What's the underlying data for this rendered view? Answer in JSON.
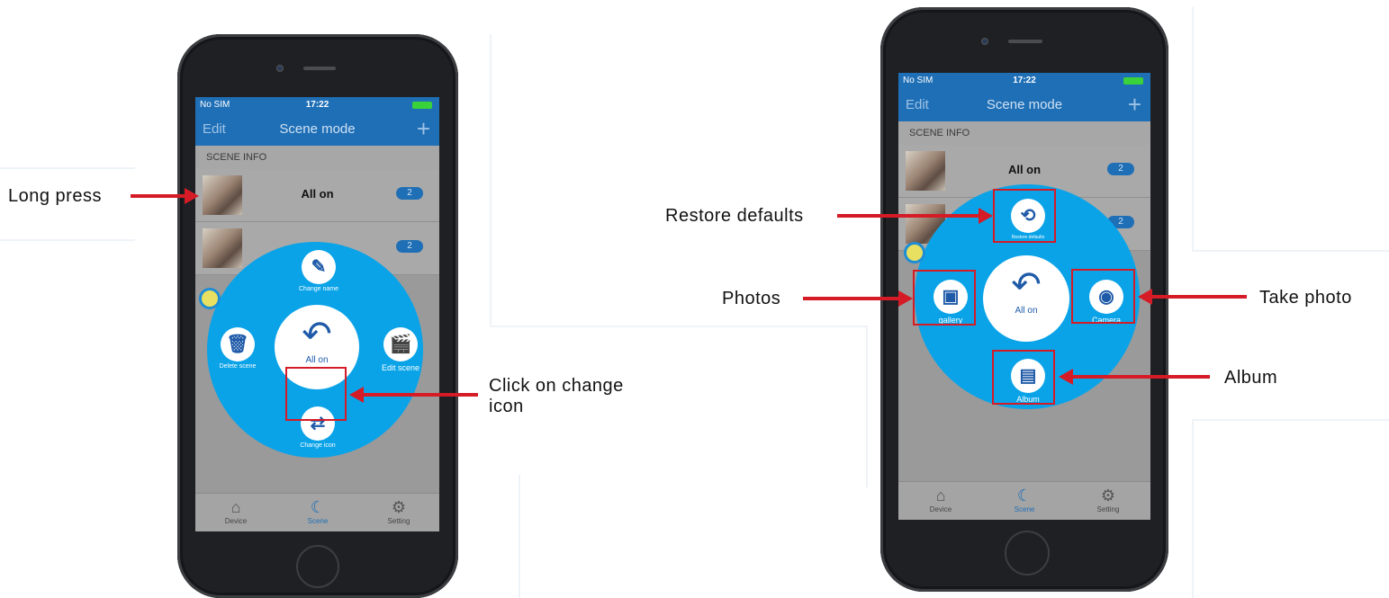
{
  "annotations": {
    "long_press": "Long press",
    "click_change_icon": "Click on change icon",
    "restore_defaults": "Restore defaults",
    "photos": "Photos",
    "take_photo": "Take photo",
    "album": "Album"
  },
  "left_phone": {
    "status": {
      "carrier": "No SIM",
      "time": "17:22"
    },
    "nav": {
      "edit": "Edit",
      "title": "Scene mode",
      "add": "+"
    },
    "section_header": "SCENE INFO",
    "scenes": [
      {
        "name": "All on",
        "count": "2"
      },
      {
        "name": "",
        "count": "2"
      }
    ],
    "menu": {
      "center_label": "All on",
      "change_name": "Change name",
      "delete_scene": "Delete scene",
      "edit_scene": "Edit scene",
      "change_icon": "Change icon"
    },
    "tabs": [
      "Device",
      "Scene",
      "Setting"
    ]
  },
  "right_phone": {
    "status": {
      "carrier": "No SIM",
      "time": "17:22"
    },
    "nav": {
      "edit": "Edit",
      "title": "Scene mode",
      "add": "+"
    },
    "section_header": "SCENE INFO",
    "scenes": [
      {
        "name": "All on",
        "count": "2"
      },
      {
        "name": "",
        "count": "2"
      }
    ],
    "menu": {
      "center_label": "All on",
      "restore_defaults": "Restore defaults",
      "gallery": "gallery",
      "camera": "Camera",
      "album": "Album"
    },
    "tabs": [
      "Device",
      "Scene",
      "Setting"
    ]
  },
  "colors": {
    "accent": "#1f6fb6",
    "menu_disc": "#0aa3e8",
    "annotation_red": "#d51b26"
  }
}
